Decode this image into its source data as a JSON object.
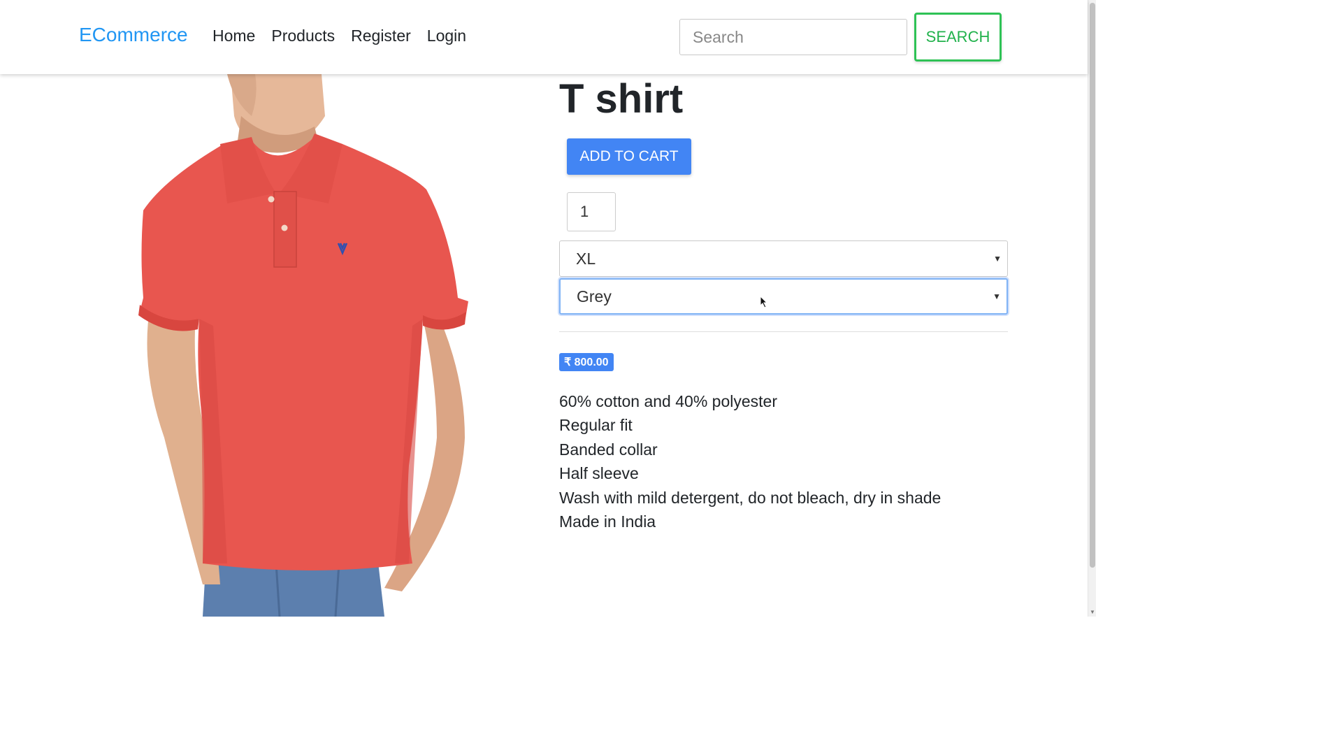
{
  "navbar": {
    "brand": "ECommerce",
    "links": [
      "Home",
      "Products",
      "Register",
      "Login"
    ],
    "search_placeholder": "Search",
    "search_button": "SEARCH"
  },
  "product": {
    "title": "T shirt",
    "add_to_cart": "ADD TO CART",
    "quantity": "1",
    "size": "XL",
    "color": "Grey",
    "price": "₹ 800.00",
    "features": [
      "60% cotton and 40% polyester",
      "Regular fit",
      "Banded collar",
      "Half sleeve",
      "Wash with mild detergent, do not bleach, dry in shade",
      "Made in India"
    ]
  },
  "colors": {
    "brand": "#2196f3",
    "primary_button": "#4285f4",
    "search_button": "#2ec255",
    "shirt": "#e8564f"
  }
}
